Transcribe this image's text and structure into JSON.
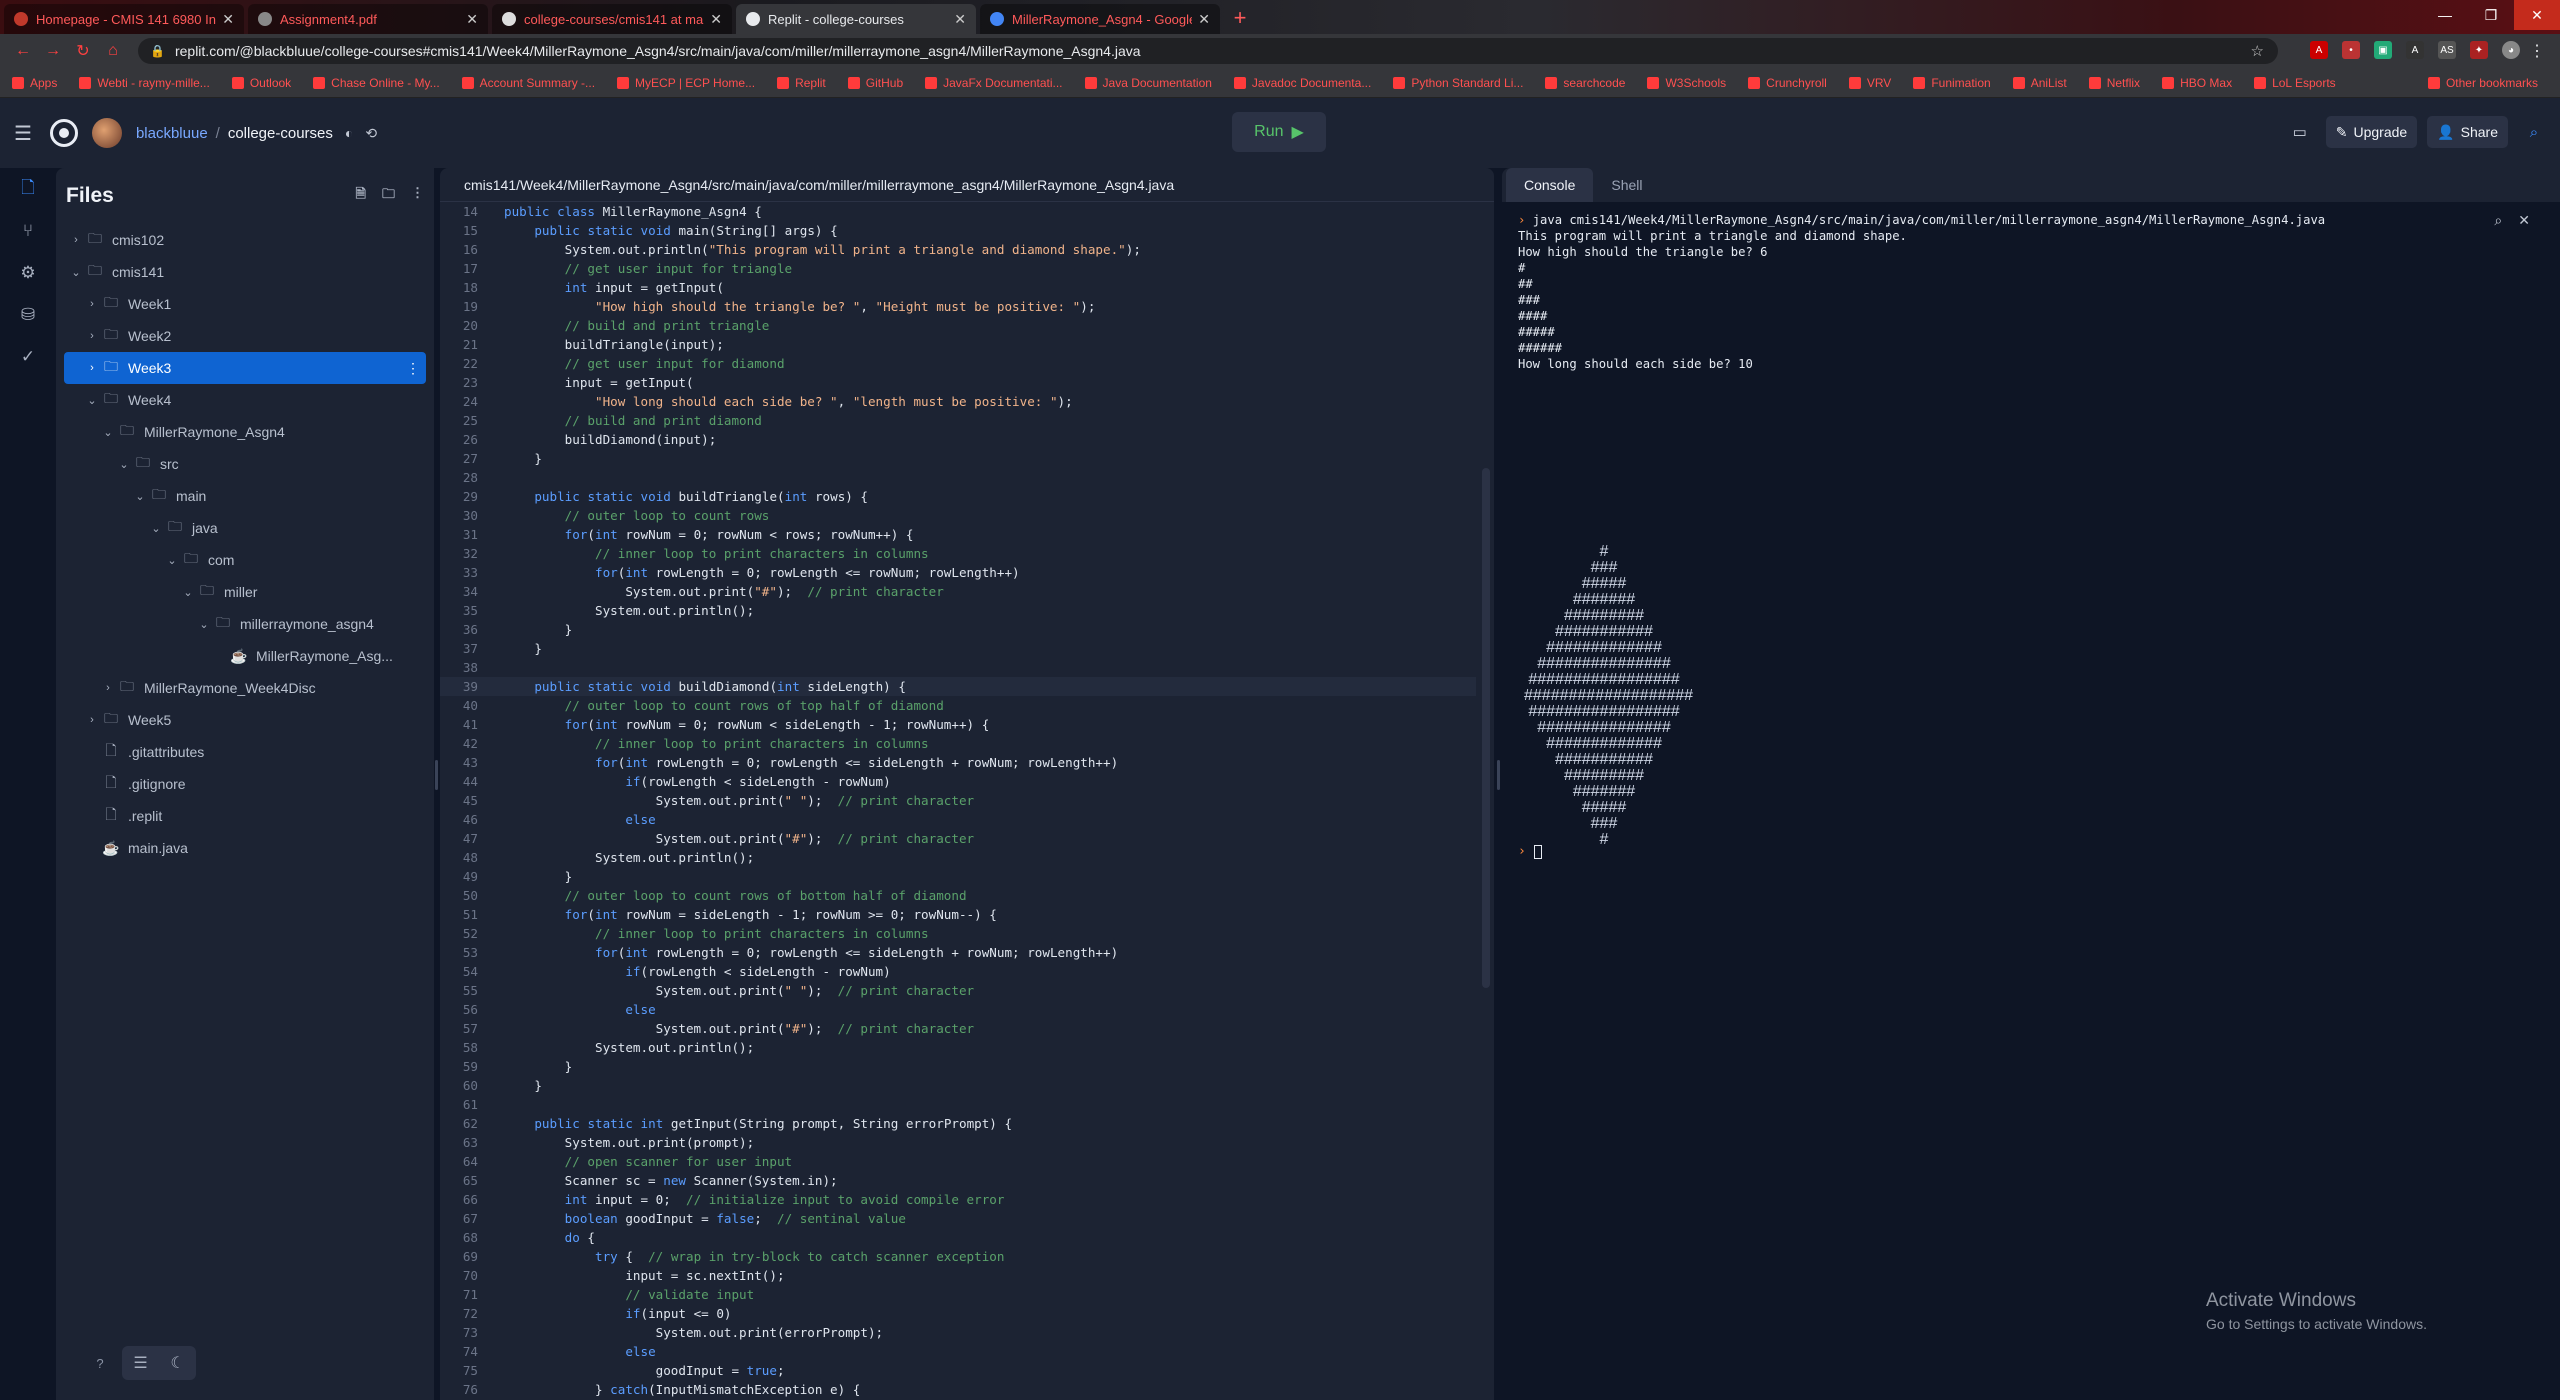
{
  "browser": {
    "tabs": [
      {
        "title": "Homepage - CMIS 141 6980 Intr...",
        "icon": "umgc-icon",
        "active": false
      },
      {
        "title": "Assignment4.pdf",
        "icon": "pdf-icon",
        "active": false
      },
      {
        "title": "college-courses/cmis141 at main",
        "icon": "github-icon",
        "active": false
      },
      {
        "title": "Replit - college-courses",
        "icon": "replit-icon",
        "active": true
      },
      {
        "title": "MillerRaymone_Asgn4 - Google",
        "icon": "docs-icon",
        "active": false
      }
    ],
    "url": "replit.com/@blackbluue/college-courses#cmis141/Week4/MillerRaymone_Asgn4/src/main/java/com/miller/millerraymone_asgn4/MillerRaymone_Asgn4.java",
    "bookmarks": [
      "Apps",
      "Webti - raymy-mille...",
      "Outlook",
      "Chase Online - My...",
      "Account Summary -...",
      "MyECP | ECP Home...",
      "Replit",
      "GitHub",
      "JavaFx Documentati...",
      "Java Documentation",
      "Javadoc Documenta...",
      "Python Standard Li...",
      "searchcode",
      "W3Schools",
      "Crunchyroll",
      "VRV",
      "Funimation",
      "AniList",
      "Netflix",
      "HBO Max",
      "LoL Esports",
      "Other bookmarks"
    ],
    "accent": "#ff3b3b"
  },
  "topbar": {
    "username": "blackbluue",
    "separator": "/",
    "project": "college-courses",
    "run_label": "Run",
    "upgrade_label": "Upgrade",
    "share_label": "Share"
  },
  "files": {
    "title": "Files",
    "tree": [
      {
        "name": "cmis102",
        "type": "folder",
        "depth": 0,
        "chev": "›"
      },
      {
        "name": "cmis141",
        "type": "folder",
        "depth": 0,
        "chev": "⌄"
      },
      {
        "name": "Week1",
        "type": "folder",
        "depth": 1,
        "chev": "›"
      },
      {
        "name": "Week2",
        "type": "folder",
        "depth": 1,
        "chev": "›"
      },
      {
        "name": "Week3",
        "type": "folder",
        "depth": 1,
        "chev": "›",
        "selected": true
      },
      {
        "name": "Week4",
        "type": "folder",
        "depth": 1,
        "chev": "⌄"
      },
      {
        "name": "MillerRaymone_Asgn4",
        "type": "folder",
        "depth": 2,
        "chev": "⌄"
      },
      {
        "name": "src",
        "type": "folder",
        "depth": 3,
        "chev": "⌄"
      },
      {
        "name": "main",
        "type": "folder",
        "depth": 4,
        "chev": "⌄"
      },
      {
        "name": "java",
        "type": "folder",
        "depth": 5,
        "chev": "⌄"
      },
      {
        "name": "com",
        "type": "folder",
        "depth": 6,
        "chev": "⌄"
      },
      {
        "name": "miller",
        "type": "folder",
        "depth": 7,
        "chev": "⌄"
      },
      {
        "name": "millerraymone_asgn4",
        "type": "folder",
        "depth": 8,
        "chev": "⌄"
      },
      {
        "name": "MillerRaymone_Asg...",
        "type": "java",
        "depth": 9,
        "chev": ""
      },
      {
        "name": "MillerRaymone_Week4Disc",
        "type": "folder",
        "depth": 2,
        "chev": "›"
      },
      {
        "name": "Week5",
        "type": "folder",
        "depth": 1,
        "chev": "›"
      },
      {
        "name": ".gitattributes",
        "type": "file",
        "depth": 1,
        "chev": ""
      },
      {
        "name": ".gitignore",
        "type": "file",
        "depth": 1,
        "chev": ""
      },
      {
        "name": ".replit",
        "type": "file",
        "depth": 1,
        "chev": ""
      },
      {
        "name": "main.java",
        "type": "java",
        "depth": 1,
        "chev": ""
      }
    ]
  },
  "editor": {
    "path": "cmis141/Week4/MillerRaymone_Asgn4/src/main/java/com/miller/millerraymone_asgn4/MillerRaymone_Asgn4.java",
    "current_line": 39,
    "lines": [
      {
        "n": 14,
        "t": "public class MillerRaymone_Asgn4 {"
      },
      {
        "n": 15,
        "t": "    public static void main(String[] args) {"
      },
      {
        "n": 16,
        "t": "        System.out.println(\"This program will print a triangle and diamond shape.\");"
      },
      {
        "n": 17,
        "t": "        // get user input for triangle"
      },
      {
        "n": 18,
        "t": "        int input = getInput("
      },
      {
        "n": 19,
        "t": "            \"How high should the triangle be? \", \"Height must be positive: \");"
      },
      {
        "n": 20,
        "t": "        // build and print triangle"
      },
      {
        "n": 21,
        "t": "        buildTriangle(input);"
      },
      {
        "n": 22,
        "t": "        // get user input for diamond"
      },
      {
        "n": 23,
        "t": "        input = getInput("
      },
      {
        "n": 24,
        "t": "            \"How long should each side be? \", \"length must be positive: \");"
      },
      {
        "n": 25,
        "t": "        // build and print diamond"
      },
      {
        "n": 26,
        "t": "        buildDiamond(input);"
      },
      {
        "n": 27,
        "t": "    }"
      },
      {
        "n": 28,
        "t": ""
      },
      {
        "n": 29,
        "t": "    public static void buildTriangle(int rows) {"
      },
      {
        "n": 30,
        "t": "        // outer loop to count rows"
      },
      {
        "n": 31,
        "t": "        for(int rowNum = 0; rowNum < rows; rowNum++) {"
      },
      {
        "n": 32,
        "t": "            // inner loop to print characters in columns"
      },
      {
        "n": 33,
        "t": "            for(int rowLength = 0; rowLength <= rowNum; rowLength++)"
      },
      {
        "n": 34,
        "t": "                System.out.print(\"#\");  // print character"
      },
      {
        "n": 35,
        "t": "            System.out.println();"
      },
      {
        "n": 36,
        "t": "        }"
      },
      {
        "n": 37,
        "t": "    }"
      },
      {
        "n": 38,
        "t": ""
      },
      {
        "n": 39,
        "t": "    public static void buildDiamond(int sideLength) {"
      },
      {
        "n": 40,
        "t": "        // outer loop to count rows of top half of diamond"
      },
      {
        "n": 41,
        "t": "        for(int rowNum = 0; rowNum < sideLength - 1; rowNum++) {"
      },
      {
        "n": 42,
        "t": "            // inner loop to print characters in columns"
      },
      {
        "n": 43,
        "t": "            for(int rowLength = 0; rowLength <= sideLength + rowNum; rowLength++)"
      },
      {
        "n": 44,
        "t": "                if(rowLength < sideLength - rowNum)"
      },
      {
        "n": 45,
        "t": "                    System.out.print(\" \");  // print character"
      },
      {
        "n": 46,
        "t": "                else"
      },
      {
        "n": 47,
        "t": "                    System.out.print(\"#\");  // print character"
      },
      {
        "n": 48,
        "t": "            System.out.println();"
      },
      {
        "n": 49,
        "t": "        }"
      },
      {
        "n": 50,
        "t": "        // outer loop to count rows of bottom half of diamond"
      },
      {
        "n": 51,
        "t": "        for(int rowNum = sideLength - 1; rowNum >= 0; rowNum--) {"
      },
      {
        "n": 52,
        "t": "            // inner loop to print characters in columns"
      },
      {
        "n": 53,
        "t": "            for(int rowLength = 0; rowLength <= sideLength + rowNum; rowLength++)"
      },
      {
        "n": 54,
        "t": "                if(rowLength < sideLength - rowNum)"
      },
      {
        "n": 55,
        "t": "                    System.out.print(\" \");  // print character"
      },
      {
        "n": 56,
        "t": "                else"
      },
      {
        "n": 57,
        "t": "                    System.out.print(\"#\");  // print character"
      },
      {
        "n": 58,
        "t": "            System.out.println();"
      },
      {
        "n": 59,
        "t": "        }"
      },
      {
        "n": 60,
        "t": "    }"
      },
      {
        "n": 61,
        "t": ""
      },
      {
        "n": 62,
        "t": "    public static int getInput(String prompt, String errorPrompt) {"
      },
      {
        "n": 63,
        "t": "        System.out.print(prompt);"
      },
      {
        "n": 64,
        "t": "        // open scanner for user input"
      },
      {
        "n": 65,
        "t": "        Scanner sc = new Scanner(System.in);"
      },
      {
        "n": 66,
        "t": "        int input = 0;  // initialize input to avoid compile error"
      },
      {
        "n": 67,
        "t": "        boolean goodInput = false;  // sentinal value"
      },
      {
        "n": 68,
        "t": "        do {"
      },
      {
        "n": 69,
        "t": "            try {  // wrap in try-block to catch scanner exception"
      },
      {
        "n": 70,
        "t": "                input = sc.nextInt();"
      },
      {
        "n": 71,
        "t": "                // validate input"
      },
      {
        "n": 72,
        "t": "                if(input <= 0)"
      },
      {
        "n": 73,
        "t": "                    System.out.print(errorPrompt);"
      },
      {
        "n": 74,
        "t": "                else"
      },
      {
        "n": 75,
        "t": "                    goodInput = true;"
      },
      {
        "n": 76,
        "t": "            } catch(InputMismatchException e) {"
      }
    ]
  },
  "console": {
    "tabs": [
      "Console",
      "Shell"
    ],
    "active_tab": "Console",
    "prompt_symbol": "›",
    "command": "java cmis141/Week4/MillerRaymone_Asgn4/src/main/java/com/miller/millerraymone_asgn4/MillerRaymone_Asgn4.java",
    "output": [
      "This program will print a triangle and diamond shape.",
      "How high should the triangle be? 6",
      "#",
      "##",
      "###",
      "####",
      "#####",
      "######",
      "How long should each side be? 10"
    ],
    "diamond": [
      "#",
      "###",
      "#####",
      "#######",
      "#########",
      "###########",
      "#############",
      "###############",
      "#################",
      "###################",
      "#################",
      "###############",
      "#############",
      "###########",
      "#########",
      "#######",
      "#####",
      "###",
      "#"
    ]
  },
  "watermark": {
    "line1": "Activate Windows",
    "line2": "Go to Settings to activate Windows."
  }
}
